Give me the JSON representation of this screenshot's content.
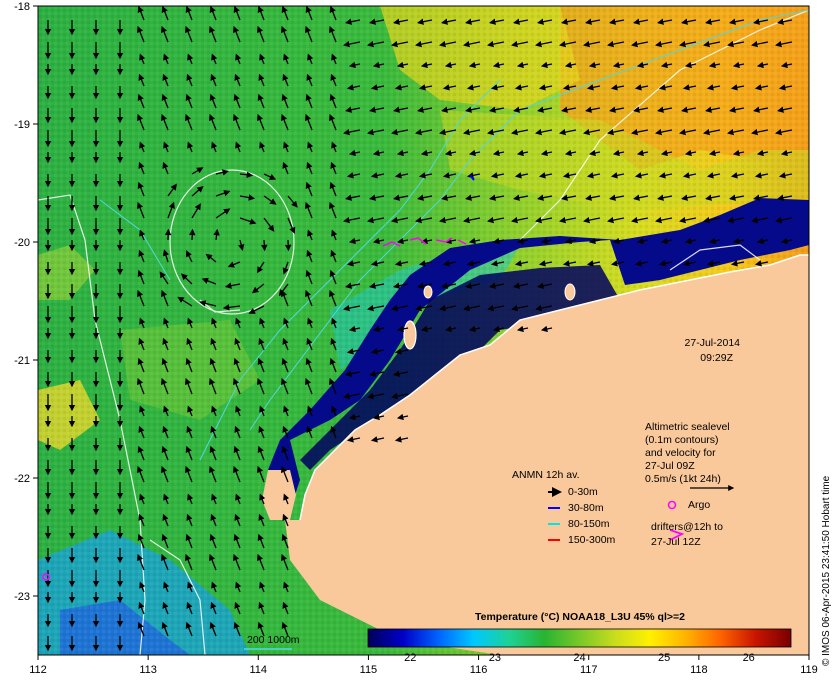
{
  "map": {
    "lon_range": [
      112,
      119
    ],
    "lat_range": [
      -23.5,
      -18
    ],
    "x_ticks": [
      "112",
      "113",
      "114",
      "115",
      "116",
      "117",
      "118",
      "119"
    ],
    "y_ticks": [
      "-18",
      "-19",
      "-20",
      "-21",
      "-22",
      "-23"
    ],
    "land_color": "#f9c89b"
  },
  "timestamp": {
    "date": "27-Jul-2014",
    "time": "09:29Z"
  },
  "altimetry": {
    "line1": "Altimetric sealevel",
    "line2": "(0.1m contours)",
    "line3": "and velocity for",
    "line4": "27-Jul 09Z",
    "line5": "0.5m/s (1kt 24h)"
  },
  "anmn": {
    "title": "ANMN 12h av.",
    "items": [
      {
        "label": "0-30m",
        "color": "#000000"
      },
      {
        "label": "30-80m",
        "color": "#0000ff"
      },
      {
        "label": "80-150m",
        "color": "#00e5e5"
      },
      {
        "label": "150-300m",
        "color": "#ff0000"
      }
    ]
  },
  "argo": {
    "label": "Argo",
    "color": "#ff00ff"
  },
  "drifters": {
    "line1": "drifters@12h to",
    "line2": "27-Jul 12Z",
    "color": "#ff00ff"
  },
  "colorbar": {
    "title": "Temperature (°C) NOAA18_L3U 45% ql>=2",
    "min": 21.5,
    "max": 26.5,
    "ticks": [
      "22",
      "23",
      "24",
      "25",
      "26"
    ],
    "stops": [
      "#00005a",
      "#0000c8",
      "#0064ff",
      "#00c8ff",
      "#1ed296",
      "#28b432",
      "#78c828",
      "#c8dc1e",
      "#fff000",
      "#ffb400",
      "#ff6400",
      "#c81400",
      "#780000"
    ]
  },
  "depth_legend": {
    "label": "200 1000m"
  },
  "credit": "© IMOS 06-Apr-2015 23:41:50 Hobart time"
}
